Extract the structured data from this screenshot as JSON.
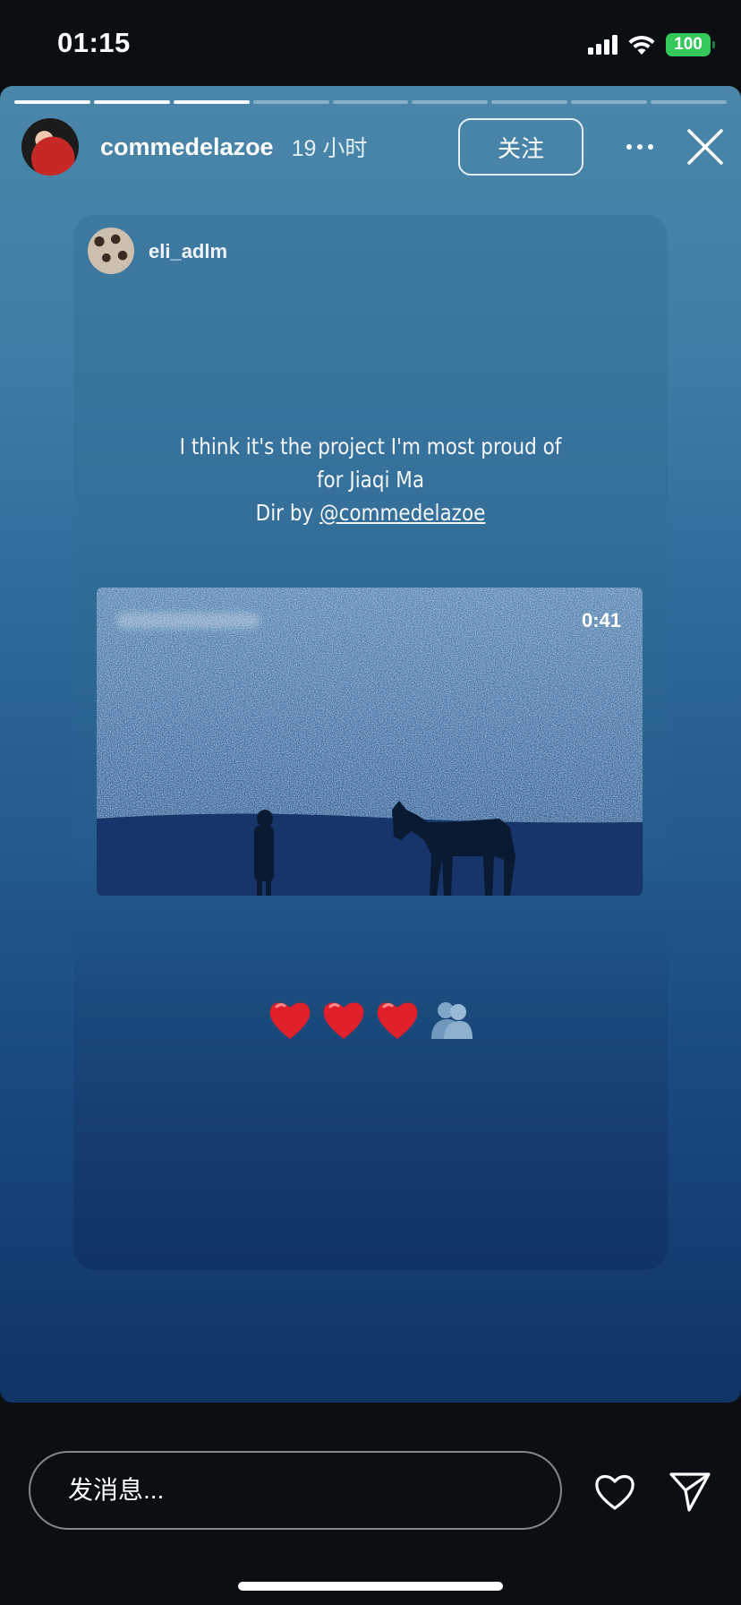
{
  "status_bar": {
    "time": "01:15",
    "battery": "100",
    "battery_color": "#34c759"
  },
  "story": {
    "segments_total": 9,
    "segments_viewed": 3,
    "header": {
      "username": "commedelazoe",
      "age": "19 小时",
      "follow_label": "关注",
      "more_icon": "more-horizontal-icon",
      "close_icon": "close-icon"
    },
    "shared_post": {
      "username": "eli_adlm",
      "caption_lines": [
        "I think it's the project I'm most proud of",
        "for Jiaqi Ma",
        "Dir by "
      ],
      "caption_mention": "@commedelazoe",
      "video": {
        "duration": "0:41"
      },
      "emojis": [
        "heart",
        "heart",
        "heart",
        "people-hugging"
      ]
    }
  },
  "footer": {
    "message_placeholder": "发消息...",
    "like_icon": "heart-outline-icon",
    "send_icon": "send-icon"
  }
}
